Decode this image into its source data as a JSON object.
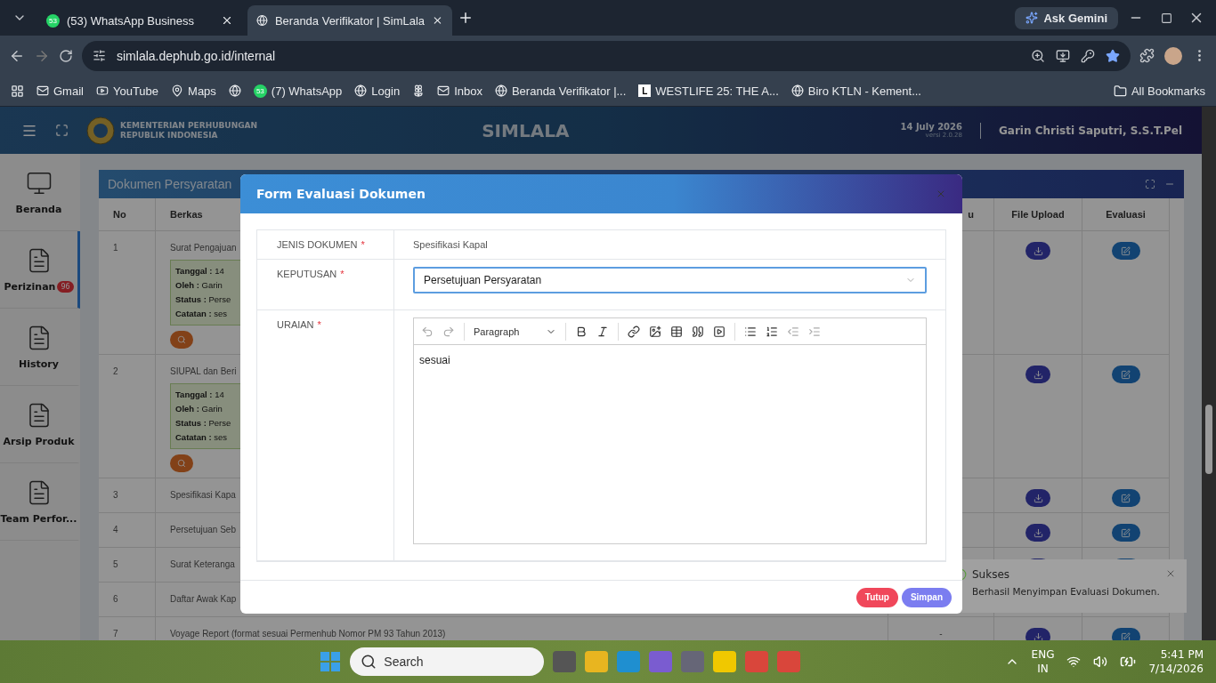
{
  "browser": {
    "tabs": [
      {
        "title": "(53) WhatsApp Business",
        "badge": "53",
        "selected": false
      },
      {
        "title": "Beranda Verifikator | SimLala",
        "selected": true
      }
    ],
    "ask_gemini": "Ask Gemini",
    "url": "simlala.dephub.go.id/internal",
    "bookmarks": [
      {
        "label": "Gmail",
        "kind": "mail"
      },
      {
        "label": "YouTube",
        "kind": "video"
      },
      {
        "label": "Maps",
        "kind": "pin"
      },
      {
        "kind": "globe"
      },
      {
        "label": "(7) WhatsApp",
        "kind": "chat",
        "badge": "53"
      },
      {
        "label": "Login",
        "kind": "globe"
      },
      {
        "kind": "flower"
      },
      {
        "label": "Inbox",
        "kind": "mail"
      },
      {
        "label": "Beranda Verifikator |...",
        "kind": "globe"
      },
      {
        "label": "WESTLIFE 25: THE A...",
        "kind": "letter",
        "letter": "L"
      },
      {
        "label": "Biro KTLN - Kement...",
        "kind": "globe"
      }
    ],
    "all_bookmarks": "All Bookmarks"
  },
  "app": {
    "org_lines": [
      "KEMENTERIAN PERHUBUNGAN",
      "REPUBLIK INDONESIA"
    ],
    "title": "SIMLALA",
    "date": "14 July 2026",
    "version": "versi 2.0.28",
    "user": "Garin Christi Saputri, S.S.T.Pel"
  },
  "sidebar": {
    "items": [
      {
        "label": "Beranda",
        "kind": "monitor",
        "selected": false
      },
      {
        "label": "Perizinan",
        "kind": "file",
        "selected": true,
        "badge": "96"
      },
      {
        "label": "History",
        "kind": "file",
        "selected": false
      },
      {
        "label": "Arsip Produk",
        "kind": "file",
        "selected": false
      },
      {
        "label": "Team Perfor...",
        "kind": "file",
        "selected": false
      }
    ]
  },
  "panel": {
    "title": "Dokumen Persyaratan",
    "columns": [
      "No",
      "Berkas",
      "u",
      "File Upload",
      "Evaluasi"
    ],
    "rows": [
      {
        "no": "1",
        "berkas": "Surat Pengajuan",
        "details": [
          "**Tanggal :** 14",
          "**Oleh :** Garin",
          "**Status :** Perse",
          "**Catatan :** ses"
        ]
      },
      {
        "no": "2",
        "berkas": "SIUPAL dan Beri",
        "details": [
          "**Tanggal :** 14",
          "**Oleh :** Garin",
          "**Status :** Perse",
          "**Catatan :** ses"
        ]
      },
      {
        "no": "3",
        "berkas": "Spesifikasi Kapa"
      },
      {
        "no": "4",
        "berkas": "Persetujuan Seb"
      },
      {
        "no": "5",
        "berkas": "Surat Keteranga"
      },
      {
        "no": "6",
        "berkas": "Daftar Awak Kap"
      },
      {
        "no": "7",
        "berkas": "Voyage Report (format sesuai Permenhub Nomor PM 93 Tahun 2013)",
        "column_3": "-"
      }
    ]
  },
  "modal": {
    "title": "Form Evaluasi Dokumen",
    "fields": [
      {
        "label": "JENIS DOKUMEN",
        "required_mark": "*",
        "kind": "text",
        "value": "Spesifikasi Kapal"
      },
      {
        "label": "KEPUTUSAN",
        "required_mark": "*",
        "kind": "select",
        "value": "Persetujuan Persyaratan"
      },
      {
        "label": "URAIAN",
        "required_mark": "*",
        "kind": "editor",
        "block_style": "Paragraph",
        "value": "sesuai"
      }
    ],
    "buttons": [
      {
        "label": "Tutup",
        "kind": "danger"
      },
      {
        "label": "Simpan",
        "kind": "primary"
      }
    ]
  },
  "toast": {
    "title": "Sukses",
    "message": "Berhasil Menyimpan Evaluasi Dokumen."
  },
  "taskbar": {
    "search_placeholder": "Search",
    "lang": [
      "ENG",
      "IN"
    ],
    "time": "5:41 PM",
    "date": "7/14/2026"
  }
}
